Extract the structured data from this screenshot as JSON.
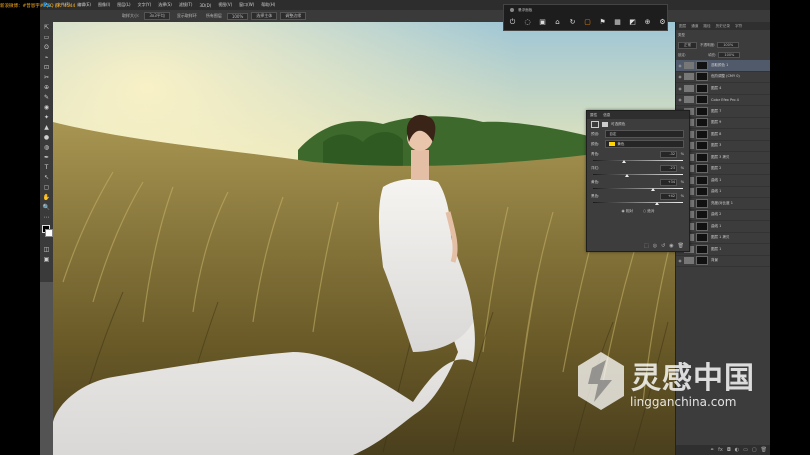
{
  "overlay": {
    "header_prefix": "新浪微博：",
    "header_name": "#曾恩宇#",
    "header_rest": "Q  Q  群：",
    "header_text": "新浪微博：#曾恩宇#  Q  Q  群：4544"
  },
  "menu": {
    "app_logo": "Ps",
    "items": [
      "文件(F)",
      "编辑(E)",
      "图像(I)",
      "图层(L)",
      "文字(Y)",
      "选择(S)",
      "滤镜(T)",
      "3D(D)",
      "视图(V)",
      "窗口(W)",
      "帮助(H)"
    ]
  },
  "options": {
    "sample_label": "取样大小:",
    "sample_value": "3x3平均",
    "show_ring": "显示取样环",
    "all_layers": "所有图层",
    "opacity": "100%",
    "select_subject": "选择主体",
    "refine": "调整边缘"
  },
  "float_toolbar": {
    "title": "悬浮面板",
    "icons": [
      "power-icon",
      "chat-icon",
      "message-icon",
      "gift-icon",
      "refresh-icon",
      "rect-icon",
      "flag-icon",
      "box-icon",
      "mask-icon",
      "globe-icon",
      "gear-icon"
    ]
  },
  "tools": [
    "⇱",
    "▭",
    "ʘ",
    "⌁",
    "⊡",
    "✂",
    "⊕",
    "✎",
    "◉",
    "✦",
    "▲",
    "●",
    "◍",
    "✒",
    "T",
    "↖",
    "▢",
    "✋",
    "🔍",
    "⋯"
  ],
  "layers_panel": {
    "tabs": [
      "图层",
      "通道",
      "路径",
      "历史记录",
      "字符"
    ],
    "kind_label": "类型",
    "blend_mode": "正常",
    "opacity_label": "不透明度:",
    "opacity_value": "100%",
    "lock_label": "锁定:",
    "fill_label": "填充:",
    "fill_value": "100%",
    "layers": [
      {
        "name": "选取颜色 1",
        "selected": true
      },
      {
        "name": "色阶调整 (CMY 0)",
        "selected": false
      },
      {
        "name": "图层 4",
        "selected": false
      },
      {
        "name": "Color Efex Pro 4",
        "selected": false
      },
      {
        "name": "图层 7",
        "selected": false
      },
      {
        "name": "图层 9",
        "selected": false
      },
      {
        "name": "图层 8",
        "selected": false
      },
      {
        "name": "图层 3",
        "selected": false
      },
      {
        "name": "图层 3 拷贝",
        "selected": false
      },
      {
        "name": "图层 2",
        "selected": false
      },
      {
        "name": "曲线 1",
        "selected": false
      },
      {
        "name": "曲线 1",
        "selected": false
      },
      {
        "name": "亮度/对比度 1",
        "selected": false
      },
      {
        "name": "曲线 2",
        "selected": false
      },
      {
        "name": "曲线 1",
        "selected": false
      },
      {
        "name": "图层 1 拷贝",
        "selected": false
      },
      {
        "name": "图层 1",
        "selected": false
      },
      {
        "name": "背景",
        "selected": false
      }
    ]
  },
  "properties": {
    "tabs": [
      "属性",
      "信息"
    ],
    "adjustment_title": "可选颜色",
    "preset_label": "预设:",
    "preset_value": "自定",
    "colors_label": "颜色:",
    "colors_value": "黄色",
    "sliders": [
      {
        "label": "青色:",
        "value": "-32",
        "position": 0.34
      },
      {
        "label": "洋红:",
        "value": "-23",
        "position": 0.38
      },
      {
        "label": "黄色:",
        "value": "+34",
        "position": 0.67
      },
      {
        "label": "黑色:",
        "value": "+42",
        "position": 0.71
      }
    ],
    "pct": "%",
    "method_relative": "相对",
    "method_absolute": "绝对"
  },
  "watermark": {
    "cn": "灵感中国",
    "en": "lingganchina.com"
  }
}
